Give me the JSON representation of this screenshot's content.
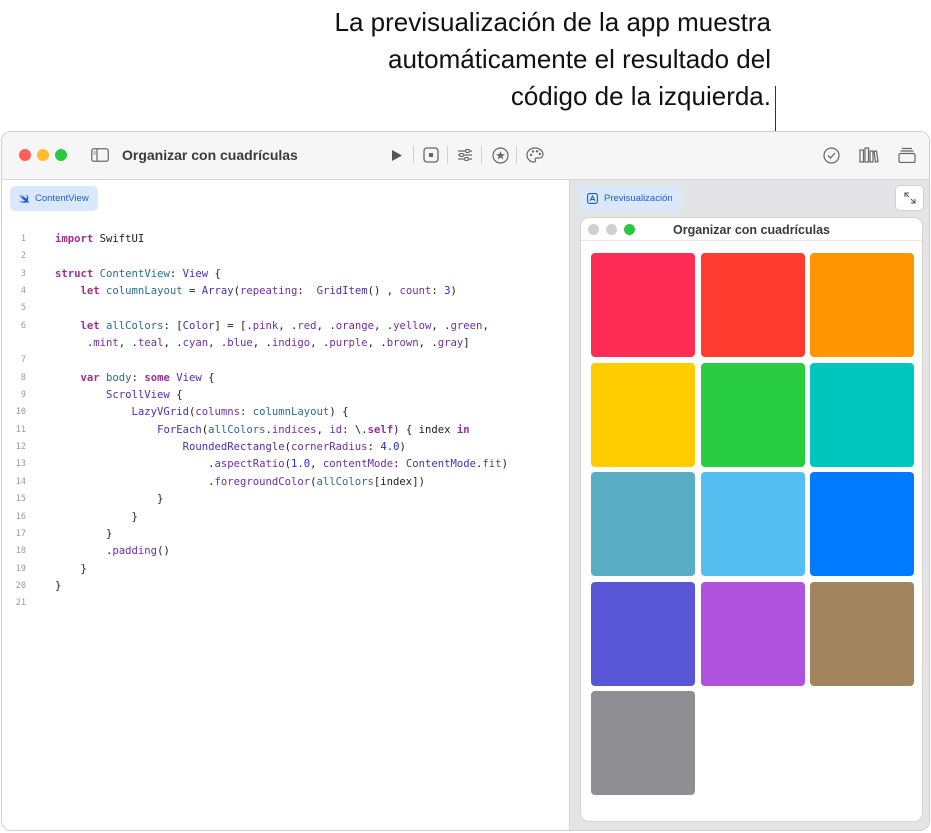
{
  "callout": {
    "lines": [
      "La previsualización de la app muestra",
      "automáticamente el resultado del",
      "código de la izquierda."
    ]
  },
  "toolbar": {
    "title": "Organizar con cuadrículas"
  },
  "editor": {
    "tab_label": "ContentView",
    "line_numbers": [
      "1",
      "2",
      "3",
      "4",
      "5",
      "6",
      "",
      "7",
      "8",
      "9",
      "10",
      "11",
      "12",
      "13",
      "14",
      "15",
      "16",
      "17",
      "18",
      "19",
      "20",
      "21"
    ]
  },
  "preview": {
    "tab_label": "Previsualización",
    "app_title": "Organizar con cuadrículas",
    "swatches": [
      {
        "name": "pink",
        "color": "#ff2d55"
      },
      {
        "name": "red",
        "color": "#ff3b30"
      },
      {
        "name": "orange",
        "color": "#ff9500"
      },
      {
        "name": "yellow",
        "color": "#ffcc00"
      },
      {
        "name": "green",
        "color": "#28cd41"
      },
      {
        "name": "mint",
        "color": "#00c7be"
      },
      {
        "name": "teal",
        "color": "#59adc4"
      },
      {
        "name": "cyan",
        "color": "#55bef0"
      },
      {
        "name": "blue",
        "color": "#007aff"
      },
      {
        "name": "indigo",
        "color": "#5856d6"
      },
      {
        "name": "purple",
        "color": "#af52de"
      },
      {
        "name": "brown",
        "color": "#a2845e"
      },
      {
        "name": "gray",
        "color": "#8e8e93"
      }
    ]
  }
}
